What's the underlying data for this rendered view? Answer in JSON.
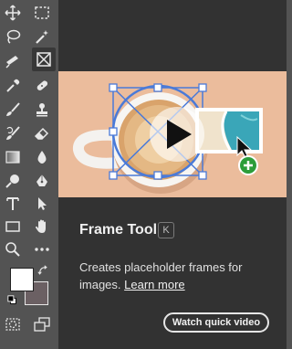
{
  "popover": {
    "tool_name": "Frame Tool",
    "shortcut": "K",
    "description": "Creates placeholder frames for images.",
    "learn_more": "Learn more",
    "watch_button": "Watch quick video"
  },
  "toolbar": {
    "tools": [
      "move-icon",
      "marquee-icon",
      "lasso-icon",
      "magic-wand-icon",
      "crop-icon",
      "frame-icon",
      "eyedropper-icon",
      "spot-healing-icon",
      "brush-icon",
      "clone-stamp-icon",
      "history-brush-icon",
      "eraser-icon",
      "gradient-icon",
      "blur-icon",
      "dodge-icon",
      "pen-icon",
      "type-icon",
      "path-selection-icon",
      "rectangle-icon",
      "hand-icon",
      "zoom-icon",
      "more-tools-icon",
      "quick-mask-icon",
      "screen-mode-icon"
    ],
    "foreground_color": "#ffffff",
    "background_color": "#6b6063"
  }
}
